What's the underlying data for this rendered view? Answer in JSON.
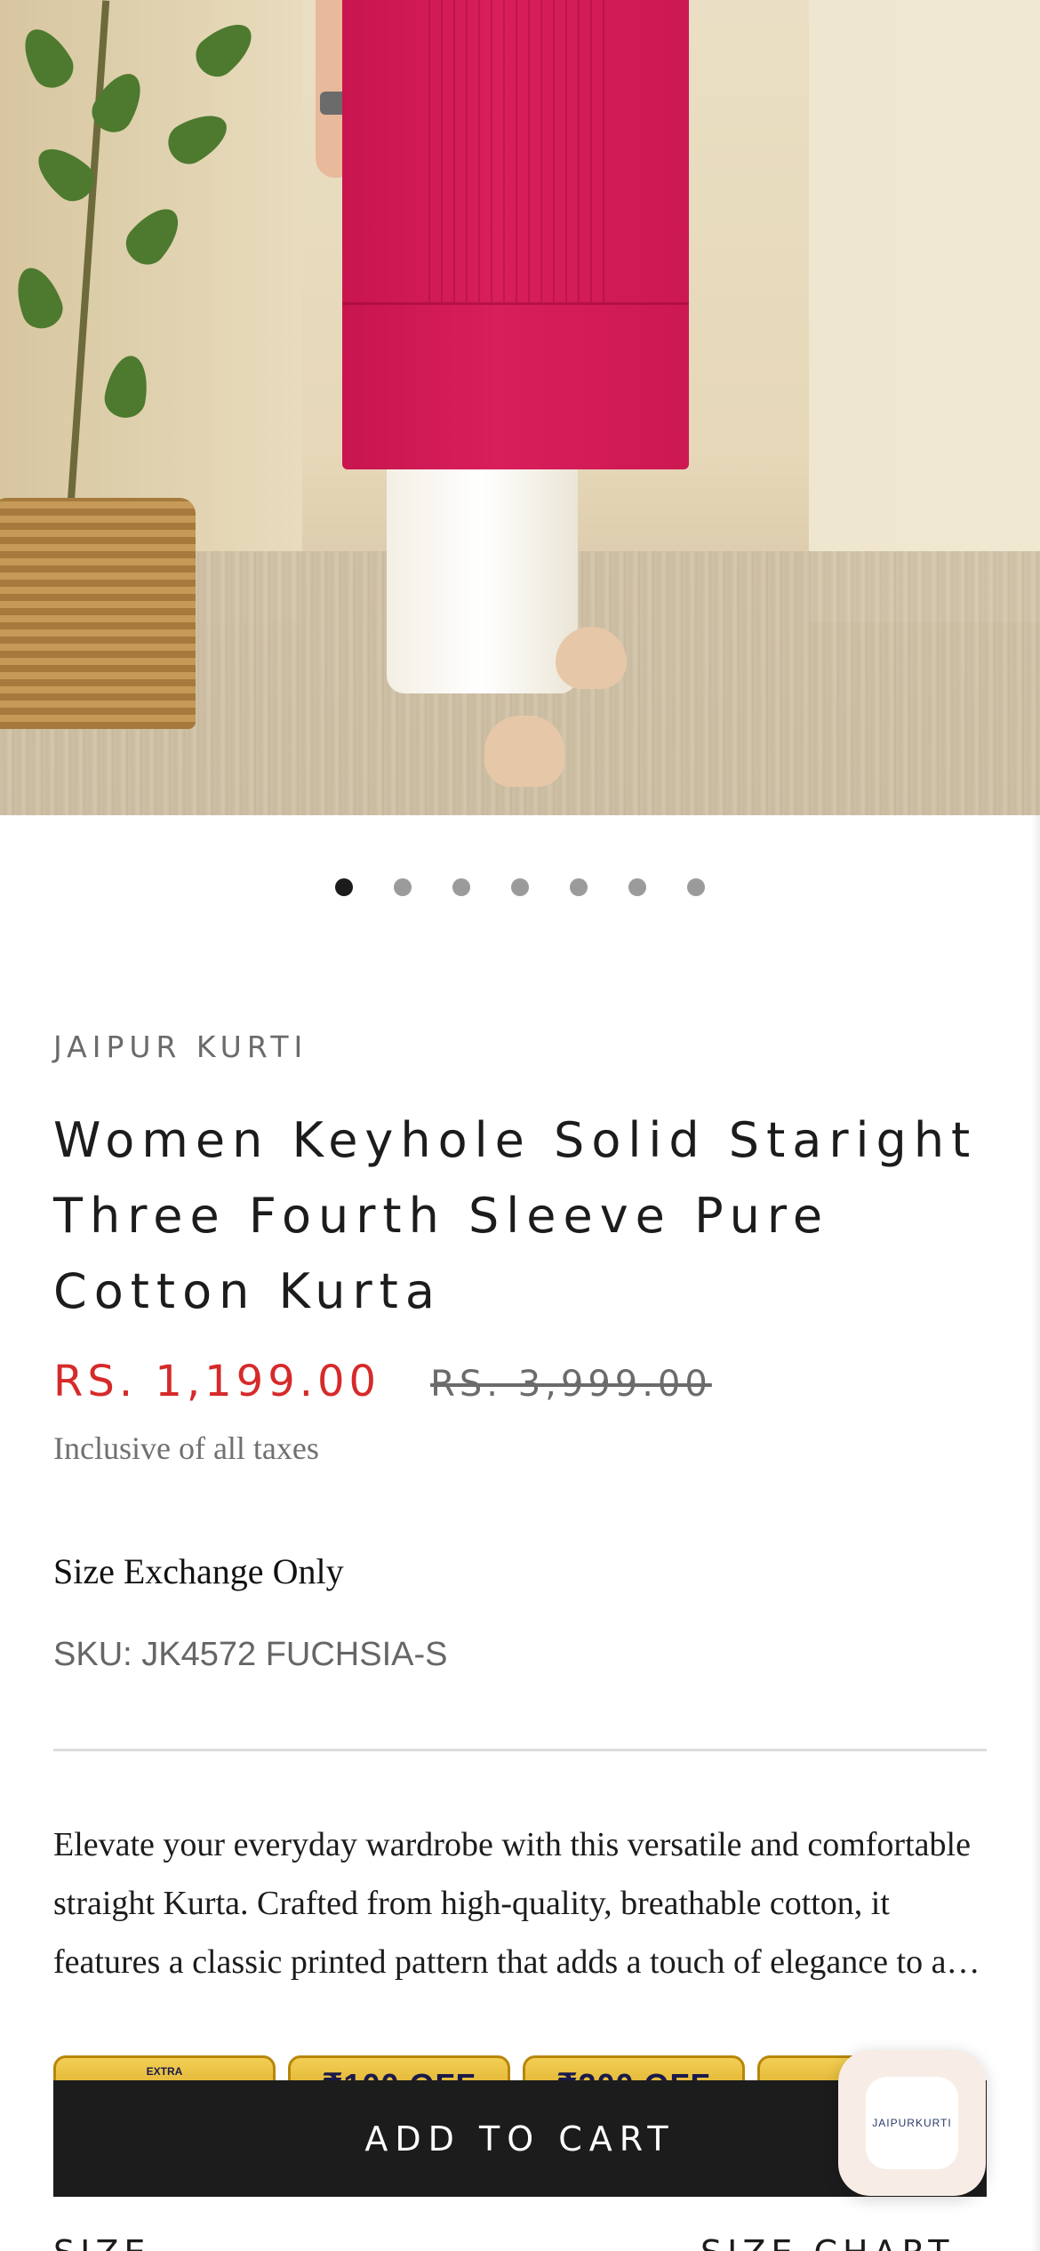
{
  "product": {
    "image_alt": "Women in fuchsia kurta and white palazzo pants",
    "brand": "JAIPUR KURTI",
    "title": "Women Keyhole Solid Staright Three Fourth Sleeve Pure Cotton Kurta",
    "price_sale": "RS. 1,199.00",
    "price_regular": "RS. 3,999.00",
    "tax_note": "Inclusive of all taxes",
    "policy": "Size Exchange Only",
    "sku": "SKU: JK4572 FUCHSIA-S",
    "description": "Elevate your everyday wardrobe with this versatile and comfortable straight Kurta. Crafted from high-quality, breathable cotton, it features a classic printed pattern that adds a touch of elegance to any look."
  },
  "carousel": {
    "count": 7,
    "active_index": 0
  },
  "offers": [
    {
      "small": "EXTRA",
      "text": ""
    },
    {
      "small": "",
      "text": "₹100 OFF"
    },
    {
      "small": "",
      "text": "₹200 OFF"
    },
    {
      "small": "",
      "text": "₹3"
    }
  ],
  "cart": {
    "add_label": "ADD TO CART"
  },
  "widget": {
    "logo_text": "JAIPURKURTI"
  },
  "bottom": {
    "size_label": "SIZE",
    "size_chart_label": "SIZE CHART"
  },
  "colors": {
    "sale_price": "#d62a2a",
    "button_bg": "#1c1c1c",
    "kurta": "#d81e5b"
  }
}
